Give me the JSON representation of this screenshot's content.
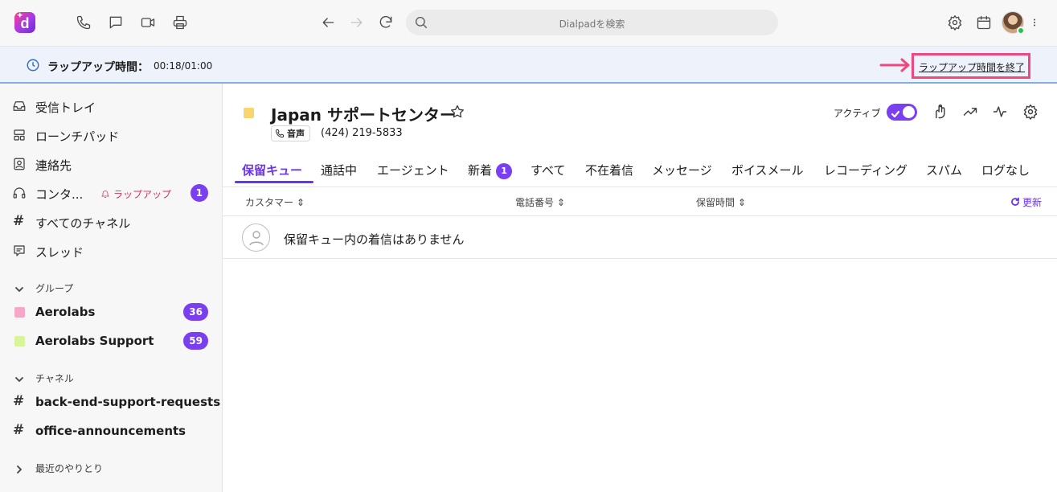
{
  "topbar": {
    "logo": "d",
    "search_placeholder": "Dialpadを検索",
    "icons": [
      "phone-icon",
      "chat-icon",
      "video-icon",
      "printer-icon",
      "back-arrow-icon",
      "forward-arrow-icon",
      "reload-icon",
      "gear-icon",
      "calendar-icon",
      "more-icon"
    ]
  },
  "banner": {
    "title": "ラップアップ時間：",
    "time": "00:18/01:00",
    "end_button": "ラップアップ時間を終了",
    "highlight_color": "#f0477f"
  },
  "sidebar": {
    "items": [
      {
        "label": "受信トレイ",
        "icon": "inbox-icon"
      },
      {
        "label": "ローンチパッド",
        "icon": "launchpad-icon"
      },
      {
        "label": "連絡先",
        "icon": "contacts-icon"
      },
      {
        "label": "コンタ...",
        "icon": "headset-icon",
        "tag": "ラップアップ",
        "badge": "1"
      },
      {
        "label": "すべてのチャネル",
        "icon": "hash-icon"
      },
      {
        "label": "スレッド",
        "icon": "thread-icon"
      }
    ],
    "groups_header": "グループ",
    "groups": [
      {
        "label": "Aerolabs",
        "badge": "36",
        "color": "#f7a8c8"
      },
      {
        "label": "Aerolabs Support",
        "badge": "59",
        "color": "#d8f59a"
      }
    ],
    "channels_header": "チャネル",
    "channels": [
      {
        "label": "back-end-support-requests"
      },
      {
        "label": "office-announcements"
      }
    ],
    "recent_header": "最近のやりとり"
  },
  "main": {
    "title": "Japan サポートセンター",
    "voice_label": "音声",
    "phone": "(424) 219-5833",
    "active_label": "アクティブ",
    "active": true,
    "tabs": [
      {
        "label": "保留キュー",
        "active": true
      },
      {
        "label": "通話中"
      },
      {
        "label": "エージェント"
      },
      {
        "label": "新着",
        "badge": "1"
      },
      {
        "label": "すべて"
      },
      {
        "label": "不在着信"
      },
      {
        "label": "メッセージ"
      },
      {
        "label": "ボイスメール"
      },
      {
        "label": "レコーディング"
      },
      {
        "label": "スパム"
      },
      {
        "label": "ログなし"
      }
    ],
    "columns": {
      "customer": "カスタマー",
      "phone": "電話番号",
      "hold_time": "保留時間",
      "refresh": "更新"
    },
    "empty_message": "保留キュー内の着信はありません"
  },
  "colors": {
    "accent": "#7b3ff2",
    "tab_active": "#6a35e8",
    "wrapup_tag": "#d6345b",
    "banner_bg": "#eef2fb"
  }
}
